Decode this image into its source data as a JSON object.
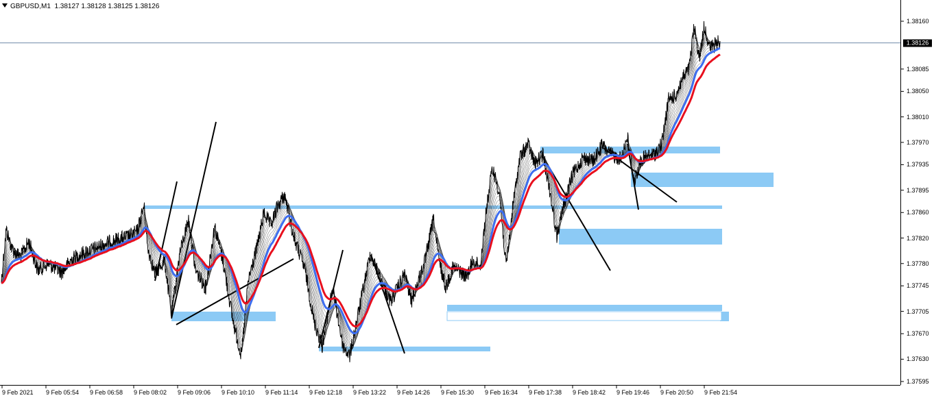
{
  "window": {
    "symbol_timeframe": "GBPUSD,M1",
    "quotes": "1.38127 1.38128 1.38125 1.38126"
  },
  "axis": {
    "y_labels": [
      "1.38160",
      "1.38085",
      "1.38050",
      "1.38010",
      "1.37970",
      "1.37935",
      "1.37895",
      "1.37860",
      "1.37820",
      "1.37780",
      "1.37745",
      "1.37705",
      "1.37670",
      "1.37630",
      "1.37595"
    ],
    "current_price": "1.38126",
    "x_labels": [
      "9 Feb 2021",
      "9 Feb 05:54",
      "9 Feb 06:58",
      "9 Feb 08:02",
      "9 Feb 09:06",
      "9 Feb 10:10",
      "9 Feb 11:14",
      "9 Feb 12:18",
      "9 Feb 13:22",
      "9 Feb 14:26",
      "9 Feb 15:30",
      "9 Feb 16:34",
      "9 Feb 17:38",
      "9 Feb 18:42",
      "9 Feb 19:46",
      "9 Feb 20:50",
      "9 Feb 21:54"
    ]
  },
  "colors": {
    "price_line": "#000000",
    "ma_red": "#e8101e",
    "ma_blue": "#3d6ef0",
    "ma_ribbon": "#333333",
    "zone": "#8ccaf5",
    "current_price_line": "#6f8aa8"
  },
  "chart_data": {
    "type": "line",
    "title": "GBPUSD,M1",
    "ylim": [
      1.37595,
      1.3818
    ],
    "x_tick_labels": [
      "9 Feb 2021",
      "9 Feb 05:54",
      "9 Feb 06:58",
      "9 Feb 08:02",
      "9 Feb 09:06",
      "9 Feb 10:10",
      "9 Feb 11:14",
      "9 Feb 12:18",
      "9 Feb 13:22",
      "9 Feb 14:26",
      "9 Feb 15:30",
      "9 Feb 16:34",
      "9 Feb 17:38",
      "9 Feb 18:42",
      "9 Feb 19:46",
      "9 Feb 20:50",
      "9 Feb 21:54"
    ],
    "series": [
      {
        "x": [
          "9 Feb 2021",
          "9 Feb 05:54",
          "9 Feb 06:58",
          "9 Feb 08:02",
          "9 Feb 09:06",
          "9 Feb 10:10",
          "9 Feb 11:14",
          "9 Feb 12:18",
          "9 Feb 13:22",
          "9 Feb 14:26",
          "9 Feb 15:30",
          "9 Feb 16:34",
          "9 Feb 17:38",
          "9 Feb 18:42",
          "9 Feb 19:46",
          "9 Feb 20:50",
          "9 Feb 21:54"
        ],
        "y": [
          1.3779,
          1.3776,
          1.3782,
          1.3784,
          1.3779,
          1.3772,
          1.3787,
          1.3765,
          1.3775,
          1.3774,
          1.3777,
          1.3791,
          1.3793,
          1.3794,
          1.3795,
          1.3802,
          1.3812
        ]
      }
    ]
  }
}
